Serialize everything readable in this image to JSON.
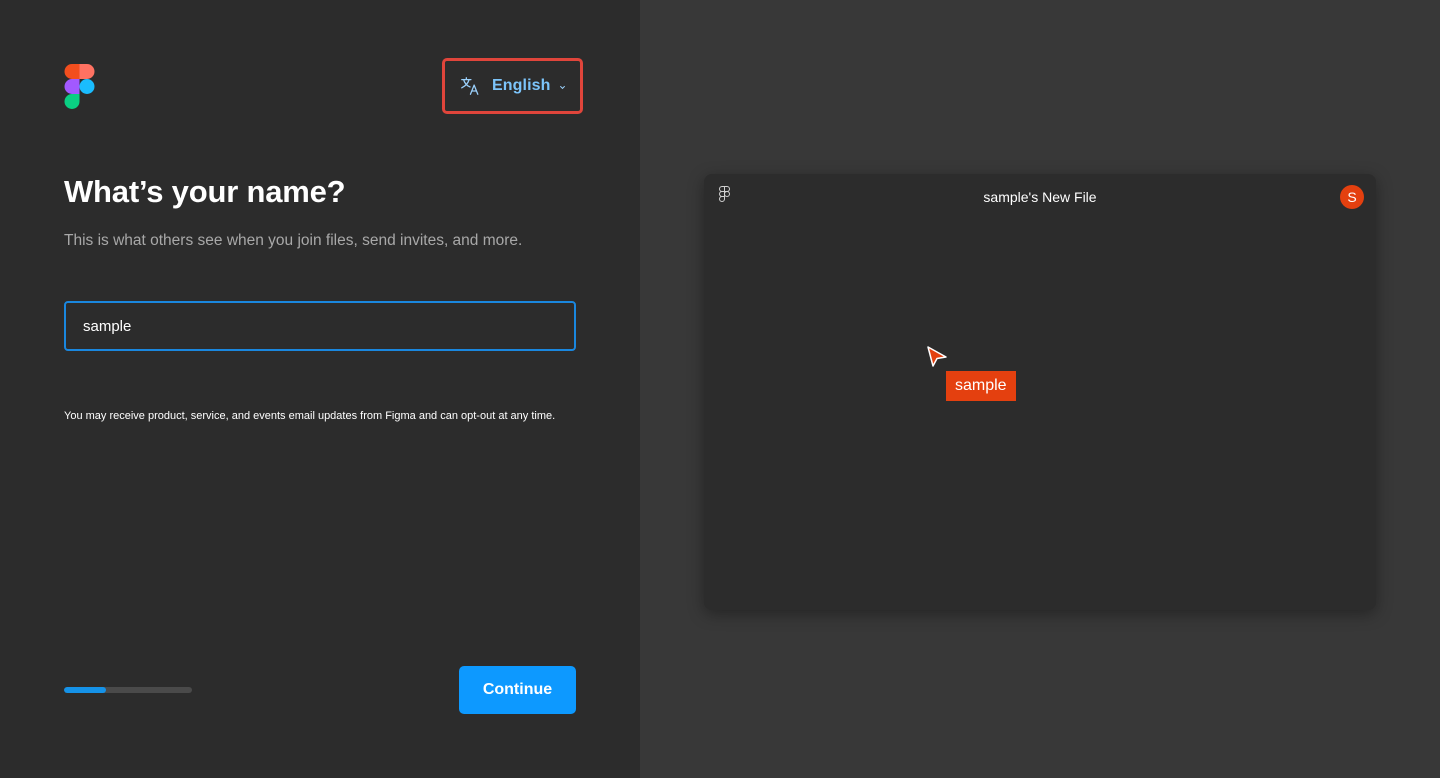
{
  "language": {
    "selected": "English",
    "icon": "translate-icon"
  },
  "heading": "What’s your name?",
  "subheading": "This is what others see when you join files, send invites, and more.",
  "name_input": {
    "value": "sample",
    "placeholder": ""
  },
  "disclaimer": "You may receive product, service, and events email updates from Figma and can opt-out at any time.",
  "progress": {
    "fraction": 0.33
  },
  "continue_label": "Continue",
  "preview": {
    "file_title": "sample's New File",
    "avatar_initial": "S",
    "cursor_label": "sample"
  },
  "colors": {
    "accent": "#0d99ff",
    "user": "#e4400f",
    "highlight": "#e0453b"
  }
}
